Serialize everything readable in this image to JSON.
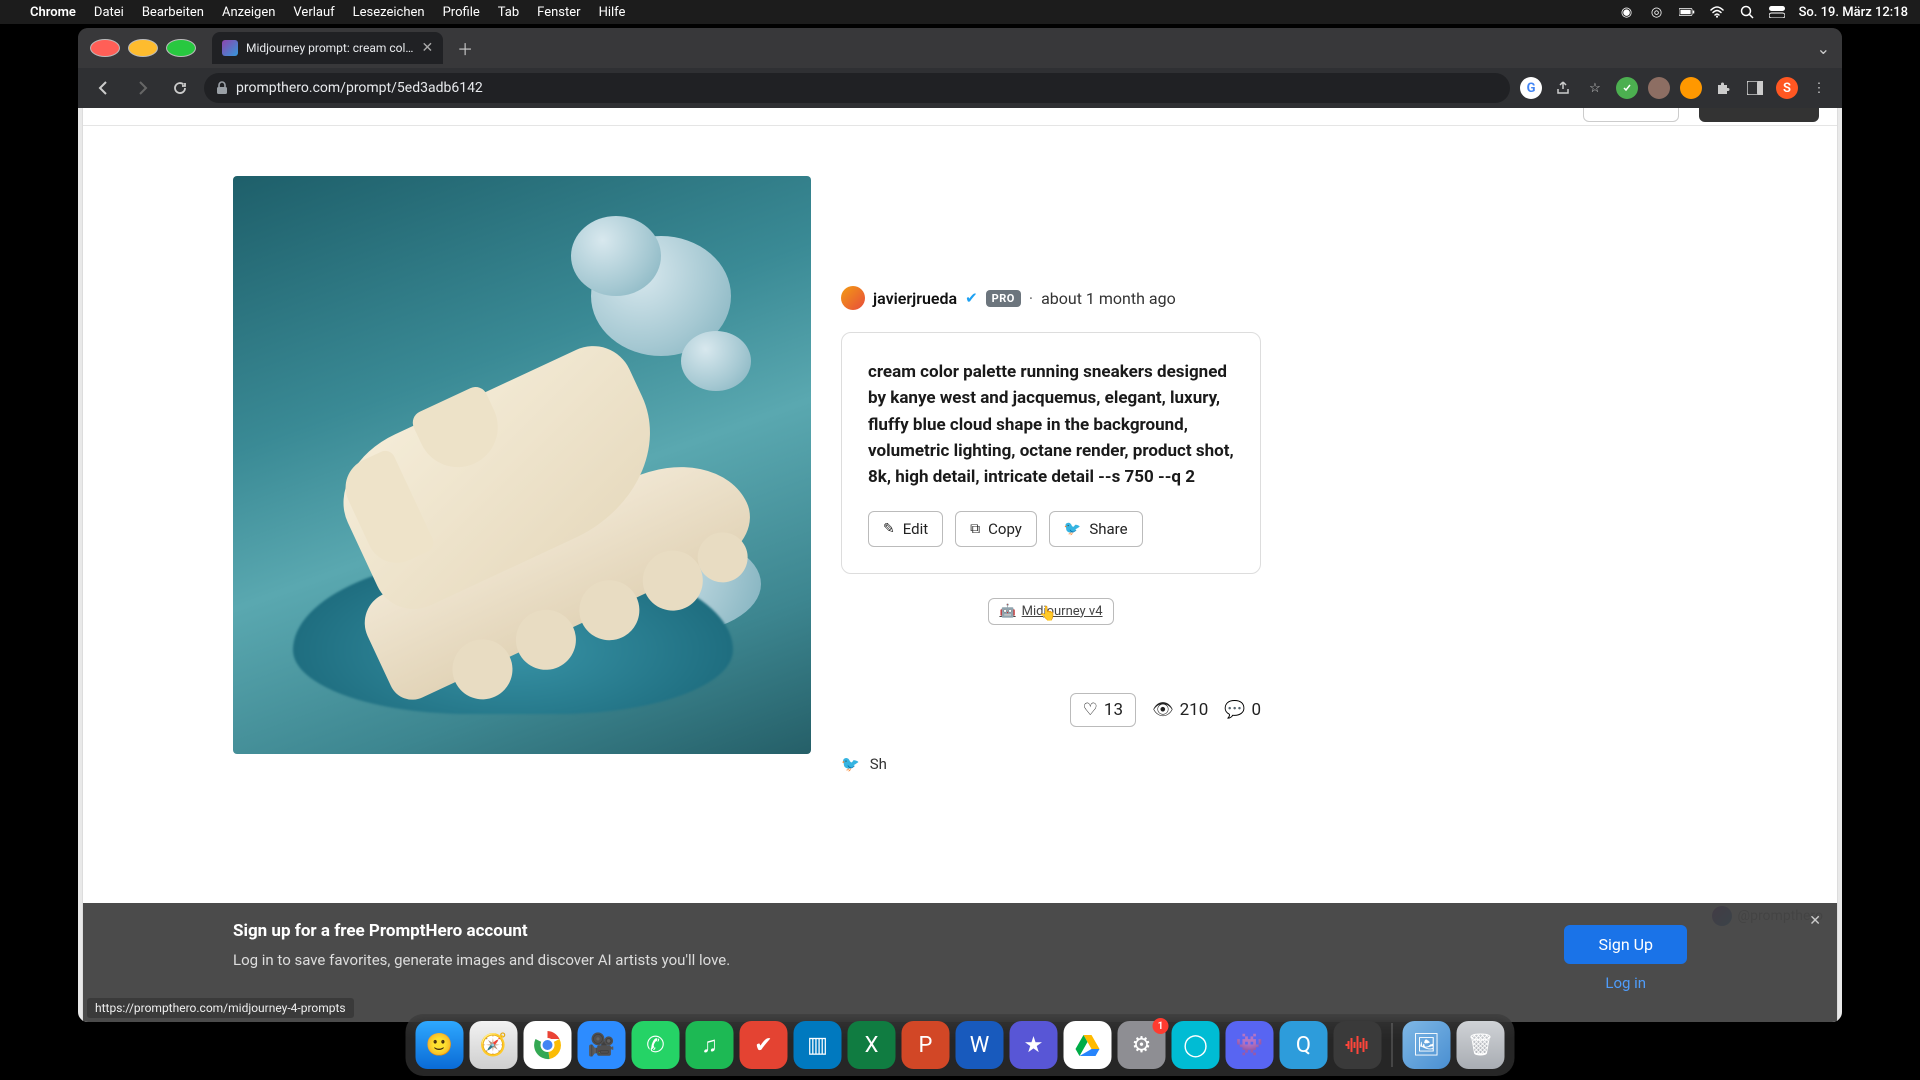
{
  "menubar": {
    "app": "Chrome",
    "items": [
      "Datei",
      "Bearbeiten",
      "Anzeigen",
      "Verlauf",
      "Lesezeichen",
      "Profile",
      "Tab",
      "Fenster",
      "Hilfe"
    ],
    "datetime": "So. 19. März  12:18"
  },
  "browser": {
    "tab_title": "Midjourney prompt: cream col…",
    "url": "prompthero.com/prompt/5ed3adb6142",
    "avatar_letter": "S"
  },
  "author": {
    "name": "javierjrueda",
    "pro": "PRO",
    "time": "about 1 month ago"
  },
  "prompt": {
    "text": "cream color palette running sneakers designed by kanye west and jacquemus, elegant, luxury, fluffy blue cloud shape in the background, volumetric lighting, octane render, product shot, 8k, high detail, intricate detail --s 750 --q 2",
    "edit": "Edit",
    "copy": "Copy",
    "share": "Share"
  },
  "model": {
    "label": "Midjourney v4"
  },
  "stats": {
    "likes": "13",
    "views": "210",
    "comments": "0"
  },
  "share_row": {
    "label": "Sh"
  },
  "credit": {
    "handle": "@prompthero"
  },
  "banner": {
    "title": "Sign up for a free PromptHero account",
    "sub": "Log in to save favorites, generate images and discover AI artists you'll love.",
    "signup": "Sign Up",
    "login": "Log in"
  },
  "status_url": "https://prompthero.com/midjourney-4-prompts",
  "dock": {
    "settings_badge": "1"
  }
}
